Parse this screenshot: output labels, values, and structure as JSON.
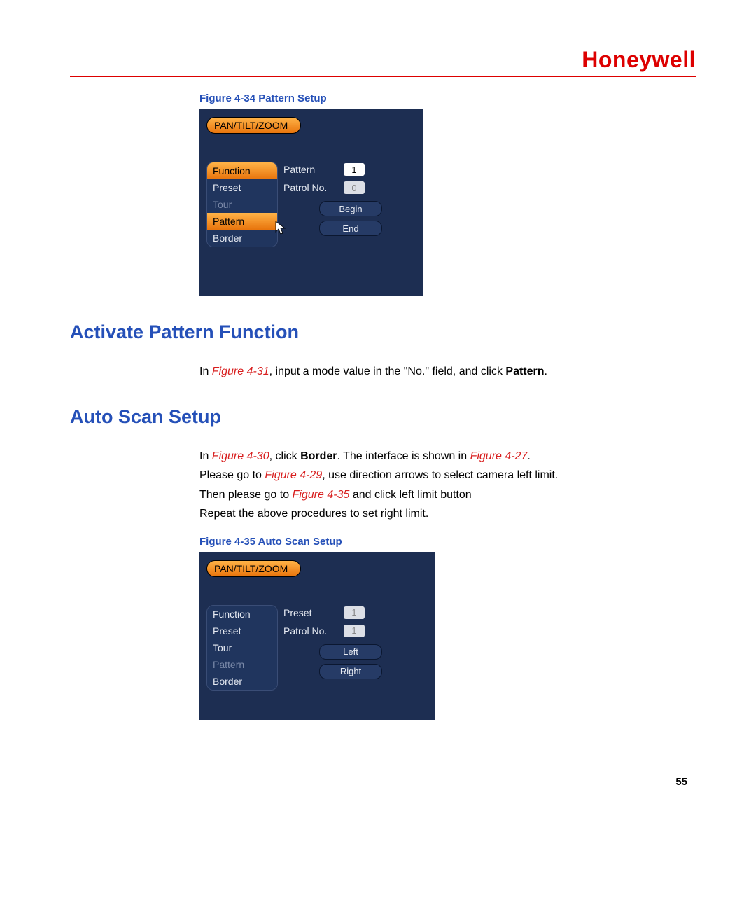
{
  "brand": "Honeywell",
  "fig34": {
    "caption": "Figure 4-34 Pattern Setup",
    "tab": "PAN/TILT/ZOOM",
    "menu": {
      "function": "Function",
      "preset": "Preset",
      "tour": "Tour",
      "pattern": "Pattern",
      "border": "Border"
    },
    "fields": {
      "pattern_label": "Pattern",
      "pattern_value": "1",
      "patrol_label": "Patrol No.",
      "patrol_value": "0"
    },
    "buttons": {
      "begin": "Begin",
      "end": "End"
    }
  },
  "section1": {
    "title": "Activate Pattern Function",
    "p_in": "In ",
    "p_ref": "Figure 4-31",
    "p_rest": ", input a mode value in the \"No.\" field, and click ",
    "p_bold": "Pattern",
    "p_dot": "."
  },
  "section2": {
    "title": "Auto Scan Setup",
    "l1_in": "In ",
    "l1_ref": "Figure 4-30",
    "l1_mid": ", click ",
    "l1_bold": "Border",
    "l1_rest": ". The interface is shown in ",
    "l1_ref2": "Figure 4-27",
    "l1_dot": ".",
    "l2_pre": "Please go to ",
    "l2_ref": "Figure 4-29",
    "l2_rest": ", use direction arrows to select camera left limit.",
    "l3_pre": "Then please go to ",
    "l3_ref": "Figure 4-35",
    "l3_rest": " and click left limit button",
    "l4": "Repeat the above procedures to set right limit."
  },
  "fig35": {
    "caption": "Figure 4-35 Auto Scan Setup",
    "tab": "PAN/TILT/ZOOM",
    "menu": {
      "function": "Function",
      "preset": "Preset",
      "tour": "Tour",
      "pattern": "Pattern",
      "border": "Border"
    },
    "fields": {
      "preset_label": "Preset",
      "preset_value": "1",
      "patrol_label": "Patrol No.",
      "patrol_value": "1"
    },
    "buttons": {
      "left": "Left",
      "right": "Right"
    }
  },
  "page_number": "55"
}
